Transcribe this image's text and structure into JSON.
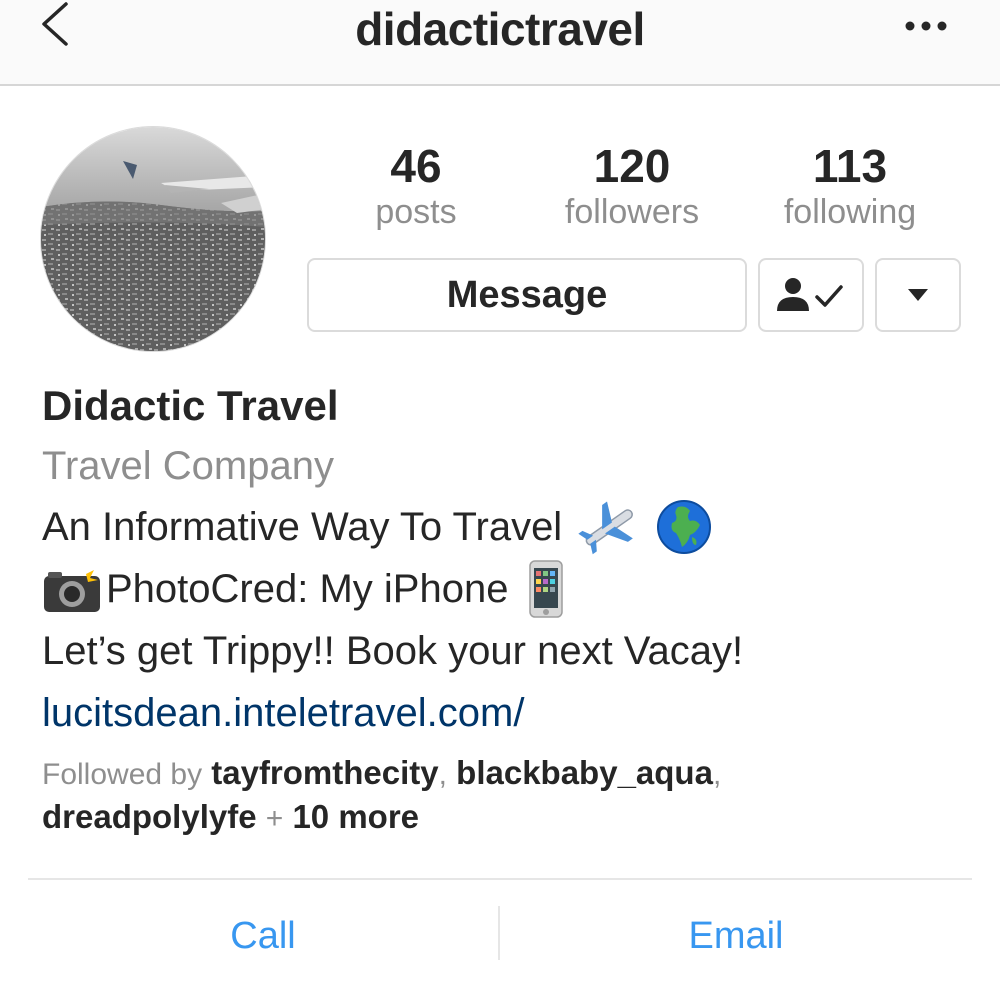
{
  "header": {
    "username": "didactictravel",
    "back_icon": "chevron-left-icon",
    "more_icon": "more-horizontal-icon"
  },
  "profile": {
    "avatar_icon": "profile-photo",
    "stats": {
      "posts_count": "46",
      "posts_label": "posts",
      "followers_count": "120",
      "followers_label": "followers",
      "following_count": "113",
      "following_label": "following"
    },
    "buttons": {
      "message_label": "Message",
      "following_icon": "person-check-icon",
      "dropdown_icon": "caret-down-icon"
    }
  },
  "bio": {
    "name": "Didactic Travel",
    "category": "Travel Company",
    "line1": "An Informative Way To Travel",
    "line2": "PhotoCred: My iPhone",
    "line3": "Let’s get Trippy!! Book your next Vacay!",
    "link": "lucitsdean.inteletravel.com/"
  },
  "followed_by": {
    "prefix": "Followed by",
    "users": [
      "tayfromthecity",
      "blackbaby_aqua",
      "dreadpolylyfe"
    ],
    "more": "10 more"
  },
  "actions": {
    "call_label": "Call",
    "email_label": "Email"
  },
  "colors": {
    "link": "#003569",
    "action_blue": "#3897f0",
    "muted": "#8e8e8e",
    "text": "#262626"
  }
}
